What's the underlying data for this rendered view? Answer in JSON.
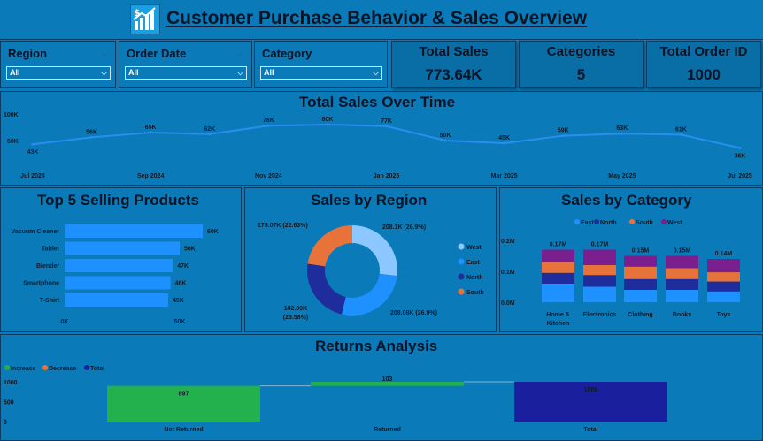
{
  "header": {
    "title": "Customer Purchase Behavior & Sales Overview",
    "logo_icon": "dollar-growth-chart-icon"
  },
  "filters": [
    {
      "label": "Region",
      "value": "All"
    },
    {
      "label": "Order Date",
      "value": "All"
    },
    {
      "label": "Category",
      "value": "All"
    }
  ],
  "kpis": [
    {
      "title": "Total Sales",
      "value": "773.64K"
    },
    {
      "title": "Categories",
      "value": "5"
    },
    {
      "title": "Total Order ID",
      "value": "1000"
    }
  ],
  "sales_over_time": {
    "title": "Total Sales Over Time",
    "y_ticks": [
      "100K",
      "50K"
    ],
    "x_ticks": [
      "Jul 2024",
      "Sep 2024",
      "Nov 2024",
      "Jan 2025",
      "Mar 2025",
      "May 2025",
      "Jul 2025"
    ],
    "point_labels": [
      "43K",
      "56K",
      "65K",
      "62K",
      "78K",
      "80K",
      "77K",
      "50K",
      "45K",
      "59K",
      "63K",
      "61K",
      "36K"
    ]
  },
  "top_products": {
    "title": "Top 5 Selling Products",
    "x_ticks": [
      "0K",
      "50K"
    ]
  },
  "sales_by_region": {
    "title": "Sales by Region",
    "slice_labels": [
      "208.1K (26.9%)",
      "208.08K (26.9%)",
      "182.39K (23.58%)",
      "175.07K (22.63%)"
    ]
  },
  "sales_by_category": {
    "title": "Sales by Category",
    "y_ticks": [
      "0.2M",
      "0.1M",
      "0.0M"
    ],
    "total_labels": [
      "0.17M",
      "0.17M",
      "0.15M",
      "0.15M",
      "0.14M"
    ]
  },
  "returns": {
    "title": "Returns Analysis",
    "legend": [
      "Increase",
      "Decrease",
      "Total"
    ],
    "y_ticks": [
      "1000",
      "500",
      "0"
    ],
    "bar_labels": [
      "897",
      "103",
      "1000"
    ]
  },
  "colors": {
    "background": "#0a7bb8",
    "line": "#2a8df0",
    "bar": "#1e90ff",
    "west": "#8cc8ff",
    "east": "#1e90ff",
    "north": "#1f2d9c",
    "south": "#e8733a",
    "category_west": "#7b1f8e",
    "increase": "#22b14c",
    "decrease": "#e8733a",
    "total": "#1a1f9e"
  },
  "chart_data": [
    {
      "type": "line",
      "title": "Total Sales Over Time",
      "x": [
        "Jul 2024",
        "Aug 2024",
        "Sep 2024",
        "Oct 2024",
        "Nov 2024",
        "Dec 2024",
        "Jan 2025",
        "Feb 2025",
        "Mar 2025",
        "Apr 2025",
        "May 2025",
        "Jun 2025",
        "Jul 2025"
      ],
      "values": [
        43000,
        56000,
        65000,
        62000,
        78000,
        80000,
        77000,
        50000,
        45000,
        59000,
        63000,
        61000,
        36000
      ],
      "ylim": [
        0,
        100000
      ]
    },
    {
      "type": "bar",
      "orientation": "horizontal",
      "title": "Top 5 Selling Products",
      "categories": [
        "Vacuum Cleaner",
        "Tablet",
        "Blender",
        "Smartphone",
        "T-Shirt"
      ],
      "values": [
        60000,
        50000,
        47000,
        46000,
        45000
      ],
      "labels": [
        "60K",
        "50K",
        "47K",
        "46K",
        "45K"
      ],
      "xlim": [
        0,
        60000
      ]
    },
    {
      "type": "pie",
      "title": "Sales by Region",
      "categories": [
        "West",
        "East",
        "North",
        "South"
      ],
      "values": [
        208100,
        208080,
        182390,
        175070
      ],
      "legend": "right"
    },
    {
      "type": "bar",
      "stacked": true,
      "title": "Sales by Category",
      "categories": [
        "Home & Kitchen",
        "Electronics",
        "Clothing",
        "Books",
        "Toys"
      ],
      "series": [
        {
          "name": "East",
          "values": [
            0.06,
            0.05,
            0.04,
            0.04,
            0.035
          ]
        },
        {
          "name": "North",
          "values": [
            0.035,
            0.038,
            0.035,
            0.035,
            0.032
          ]
        },
        {
          "name": "South",
          "values": [
            0.035,
            0.032,
            0.04,
            0.035,
            0.03
          ]
        },
        {
          "name": "West",
          "values": [
            0.04,
            0.05,
            0.035,
            0.04,
            0.043
          ]
        }
      ],
      "totals": [
        0.17,
        0.17,
        0.15,
        0.15,
        0.14
      ],
      "ylim": [
        0,
        0.2
      ],
      "legend": "top"
    },
    {
      "type": "bar",
      "subtype": "waterfall",
      "title": "Returns Analysis",
      "categories": [
        "Not Returned",
        "Returned",
        "Total"
      ],
      "values": [
        897,
        103,
        1000
      ],
      "kinds": [
        "Increase",
        "Increase",
        "Total"
      ],
      "ylim": [
        0,
        1000
      ],
      "legend": "top-left"
    }
  ]
}
